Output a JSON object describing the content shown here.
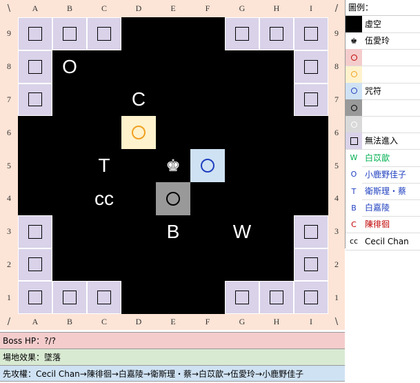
{
  "board": {
    "columns": [
      "A",
      "B",
      "C",
      "D",
      "E",
      "F",
      "G",
      "H",
      "I"
    ],
    "rows": [
      "9",
      "8",
      "7",
      "6",
      "5",
      "4",
      "3",
      "2",
      "1"
    ],
    "corner_tl": "\\",
    "corner_tr": "/",
    "corner_bl": "/",
    "corner_br": "\\",
    "blocked_cells": [
      "A9",
      "B9",
      "C9",
      "G9",
      "H9",
      "I9",
      "A8",
      "I8",
      "A7",
      "I7",
      "A3",
      "I3",
      "A2",
      "I2",
      "A1",
      "B1",
      "C1",
      "G1",
      "H1",
      "I1"
    ],
    "circles": [
      {
        "cell": "D6",
        "bg": "#fff2cc",
        "ring": "#f0a020"
      },
      {
        "cell": "F5",
        "bg": "#cfe2f3",
        "ring": "#1f3fbf"
      },
      {
        "cell": "E4",
        "bg": "#999999",
        "ring": "#000000"
      }
    ],
    "tokens": [
      {
        "cell": "B8",
        "label": "O"
      },
      {
        "cell": "D7",
        "label": "C"
      },
      {
        "cell": "C5",
        "label": "T"
      },
      {
        "cell": "C4",
        "label": "cc"
      },
      {
        "cell": "E3",
        "label": "B"
      },
      {
        "cell": "G3",
        "label": "W"
      }
    ],
    "boss": {
      "cell": "E5",
      "icon": "♚"
    }
  },
  "legend": {
    "title": "圖例：",
    "items": [
      {
        "symbol": "",
        "swatch_bg": "#000000",
        "text": "虛空"
      },
      {
        "symbol": "♚",
        "swatch_bg": "#ffffff",
        "text": "伍愛玲"
      },
      {
        "symbol": "ring",
        "swatch_bg": "#f4cccc",
        "ring": "#c00000",
        "text": ""
      },
      {
        "symbol": "ring",
        "swatch_bg": "#fff2cc",
        "ring": "#f0a020",
        "text": ""
      },
      {
        "symbol": "ring",
        "swatch_bg": "#cfe2f3",
        "ring": "#1f3fbf",
        "text": "咒符"
      },
      {
        "symbol": "ring",
        "swatch_bg": "#999999",
        "ring": "#000000",
        "text": ""
      },
      {
        "symbol": "ring",
        "swatch_bg": "#d9d9d9",
        "ring": "#ffffff",
        "text": ""
      },
      {
        "symbol": "square",
        "swatch_bg": "#d9d2e9",
        "text": "無法進入"
      },
      {
        "symbol": "W",
        "swatch_bg": "#ffffff",
        "color": "#00b050",
        "text": "白苡歆"
      },
      {
        "symbol": "O",
        "swatch_bg": "#ffffff",
        "color": "#1f3fbf",
        "text": "小鹿野佳子"
      },
      {
        "symbol": "T",
        "swatch_bg": "#ffffff",
        "color": "#1f3fbf",
        "text": "衛斯理・蔡"
      },
      {
        "symbol": "B",
        "swatch_bg": "#ffffff",
        "color": "#1f3fbf",
        "text": "白嘉陵"
      },
      {
        "symbol": "C",
        "swatch_bg": "#ffffff",
        "color": "#c00000",
        "text": "陳徘徊"
      },
      {
        "symbol": "cc",
        "swatch_bg": "#ffffff",
        "color": "#000000",
        "text": "Cecil Chan"
      }
    ]
  },
  "footer": {
    "boss_hp": "Boss HP：?/?",
    "field_effect": "場地效果：墜落",
    "turn_order": "先攻權：Cecil Chan→陳徘徊→白嘉陵→衛斯理・蔡→白苡歆→伍愛玲→小鹿野佳子",
    "colors": {
      "boss_hp_bg": "#f4cccc",
      "field_bg": "#d9ead3",
      "turn_bg": "#cfe2f3"
    }
  }
}
